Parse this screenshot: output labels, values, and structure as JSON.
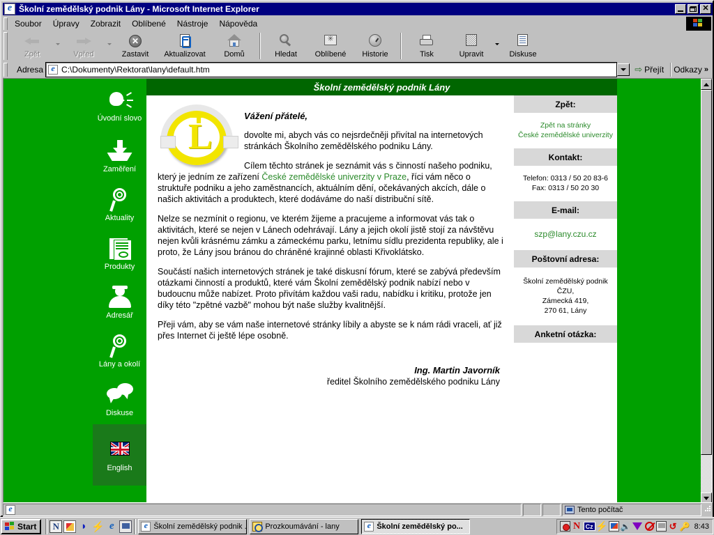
{
  "window": {
    "title": "Školní zemědělský podnik Lány - Microsoft Internet Explorer",
    "minimize_label": "_",
    "maximize_label": "□",
    "close_label": "✕"
  },
  "menu": [
    {
      "label": "Soubor",
      "accel": "S"
    },
    {
      "label": "Úpravy",
      "accel": "p"
    },
    {
      "label": "Zobrazit",
      "accel": "Z"
    },
    {
      "label": "Oblíbené",
      "accel": "O"
    },
    {
      "label": "Nástroje",
      "accel": "N"
    },
    {
      "label": "Nápověda",
      "accel": "v"
    }
  ],
  "toolbar": {
    "buttons": [
      {
        "label": "Zpět",
        "icon": "back-arrow-icon",
        "disabled": true,
        "dropdown": true
      },
      {
        "label": "Vpřed",
        "icon": "forward-arrow-icon",
        "disabled": true,
        "dropdown": true
      },
      {
        "label": "Zastavit",
        "icon": "stop-icon",
        "disabled": false,
        "dropdown": false
      },
      {
        "label": "Aktualizovat",
        "icon": "refresh-icon",
        "disabled": false,
        "dropdown": false
      },
      {
        "label": "Domů",
        "icon": "home-icon",
        "disabled": false,
        "dropdown": false
      },
      {
        "label": "Hledat",
        "icon": "search-icon",
        "disabled": false,
        "dropdown": false
      },
      {
        "label": "Oblíbené",
        "icon": "favorites-icon",
        "disabled": false,
        "dropdown": false
      },
      {
        "label": "Historie",
        "icon": "history-icon",
        "disabled": false,
        "dropdown": false
      },
      {
        "label": "Tisk",
        "icon": "print-icon",
        "disabled": false,
        "dropdown": false
      },
      {
        "label": "Upravit",
        "icon": "edit-icon",
        "disabled": false,
        "dropdown": true
      },
      {
        "label": "Diskuse",
        "icon": "discuss-icon",
        "disabled": false,
        "dropdown": false
      }
    ]
  },
  "address": {
    "label": "Adresa",
    "value": "C:\\Dokumenty\\Rektorat\\lany\\default.htm",
    "go_label": "Přejít",
    "links_label": "Odkazy",
    "links_chevron": "»"
  },
  "nav": {
    "items": [
      {
        "label": "Úvodní slovo",
        "icon": "speaking-head-icon"
      },
      {
        "label": "Zaměření",
        "icon": "download-arrow-icon"
      },
      {
        "label": "Aktuality",
        "icon": "magnifier-icon"
      },
      {
        "label": "Produkty",
        "icon": "document-list-icon"
      },
      {
        "label": "Adresář",
        "icon": "person-icon"
      },
      {
        "label": "Lány a okolí",
        "icon": "magnifier-icon"
      },
      {
        "label": "Diskuse",
        "icon": "speech-bubbles-icon"
      },
      {
        "label": "English",
        "icon": "uk-flag-icon",
        "highlight": true
      }
    ]
  },
  "page": {
    "banner": "Školní zemědělský podnik Lány",
    "logo_letter": "L",
    "greeting": "Vážení přátelé,",
    "paragraph1_before": "dovolte mi, abych vás co nejsrdečněji přivítal na internetových stránkách Školního zemědělského podniku Lány.",
    "paragraph2_part1": "Cílem těchto stránek je seznámit vás s činností našeho podniku, který je jedním ze zařízení ",
    "paragraph2_link": "České zemědělské univerzity v Praze",
    "paragraph2_part2": ", říci vám něco o struktuře podniku a jeho zaměstnancích, aktuálním dění, očekávaných akcích, dále o našich aktivitách a produktech, které dodáváme do naší distribuční sítě.",
    "paragraph3": "Nelze se nezmínit o regionu, ve kterém žijeme a pracujeme a informovat vás tak o aktivitách, které se nejen v Lánech odehrávají. Lány a jejich okolí jistě stojí za návštěvu nejen kvůli krásnému zámku a zámeckému parku, letnímu sídlu prezidenta republiky, ale i proto, že Lány jsou bránou do chráněné krajinné oblasti Křivoklátsko.",
    "paragraph4": "Součástí našich internetových stránek je také diskusní fórum, které se zabývá především otázkami činností a produktů, které vám Školní zemědělský podnik nabízí nebo v budoucnu může nabízet. Proto přivítám každou vaši radu, nabídku i kritiku, protože jen díky této \"zpětné vazbě\" mohou být naše služby kvalitnější.",
    "paragraph5": "Přeji vám, aby se vám naše internetové stránky líbily a abyste se k nám rádi vraceli, ať již přes Internet či ještě lépe osobně.",
    "signature_name": "Ing. Martin Javorník",
    "signature_role": "ředitel Školního zemědělského podniku Lány"
  },
  "infopanel": {
    "back_header": "Zpět:",
    "back_line1": "Zpět na stránky",
    "back_line2": "České zemědělské univerzity",
    "contact_header": "Kontakt:",
    "contact_phone": "Telefon: 0313 / 50 20 83-6",
    "contact_fax": "Fax: 0313 / 50 20 30",
    "email_header": "E-mail:",
    "email_value": "szp@lany.czu.cz",
    "address_header": "Poštovní adresa:",
    "address_line1": "Školní zemědělský podnik ČZU,",
    "address_line2": "Zámecká 419,",
    "address_line3": "270 61, Lány",
    "poll_header": "Anketní otázka:"
  },
  "statusbar": {
    "text": "",
    "zone": "Tento počítač"
  },
  "taskbar": {
    "start_label": "Start",
    "quicklaunch": [
      {
        "icon": "netscape-icon"
      },
      {
        "icon": "paint-icon"
      },
      {
        "icon": "messenger-icon"
      },
      {
        "icon": "flash-icon"
      },
      {
        "icon": "internet-explorer-icon"
      },
      {
        "icon": "show-desktop-icon"
      }
    ],
    "tasks": [
      {
        "label": "Školní zemědělský podnik ...",
        "icon": "ie-icon",
        "active": false
      },
      {
        "label": "Prozkoumávání - lany",
        "icon": "folder-icon",
        "active": false
      },
      {
        "label": "Školní zemědělský po...",
        "icon": "ie-icon",
        "active": true
      }
    ],
    "tray": [
      {
        "icon": "clock-alarm-icon"
      },
      {
        "icon": "norton-icon",
        "label": "N"
      },
      {
        "icon": "keyboard-layout-icon",
        "label": "Cz"
      },
      {
        "icon": "bolt-icon"
      },
      {
        "icon": "screen-icon"
      },
      {
        "icon": "speaker-icon"
      },
      {
        "icon": "triangle-icon"
      },
      {
        "icon": "no-entry-icon"
      },
      {
        "icon": "monitor-icon"
      },
      {
        "icon": "refresh-circle-icon"
      },
      {
        "icon": "key-icon"
      }
    ],
    "clock": "8:43"
  },
  "colors": {
    "titlebar": "#000080",
    "chrome": "#c0c0c0",
    "page_green": "#00a000",
    "banner_green": "#006600",
    "link_green": "#2a8a2a",
    "logo_yellow": "#f2e500",
    "panel_header_gray": "#d8d8d8"
  }
}
